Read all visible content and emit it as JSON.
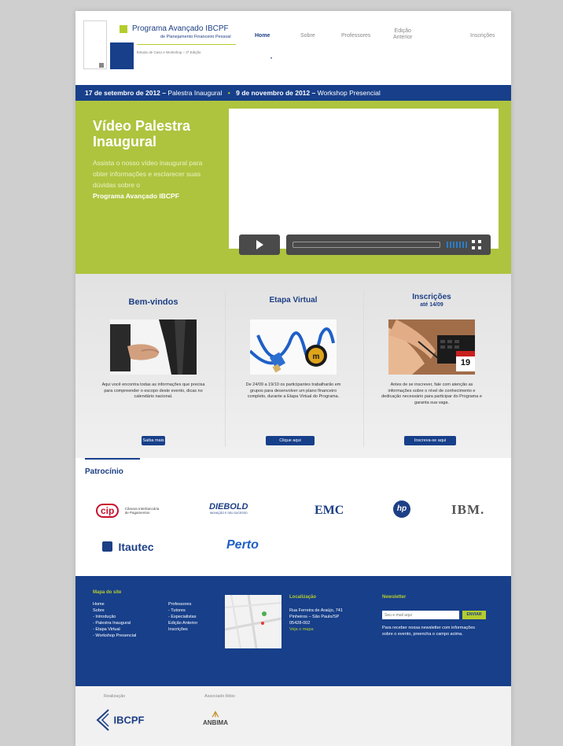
{
  "header": {
    "title": "Programa Avançado IBCPF",
    "subtitle": "de Planejamento Financeiro Pessoal",
    "tagline": "Estudo de Caso e Workshop – 2ª Edição"
  },
  "nav": {
    "items": [
      {
        "label": "Home"
      },
      {
        "label": "Sobre"
      },
      {
        "label": "Professores"
      },
      {
        "label": "Edição\nAnterior"
      },
      {
        "label": "Inscrições"
      }
    ]
  },
  "datebar": {
    "date1": "17 de setembro de 2012 –",
    "event1": "Palestra Inaugural",
    "bullet": "•",
    "date2": "9 de novembro de 2012 –",
    "event2": "Workshop Presencial"
  },
  "hero": {
    "title": "Vídeo Palestra Inaugural",
    "text": "Assista o nosso vídeo inaugural para obter informações e esclarecer suas dúvidas sobre o",
    "highlight": "Programa Avançado IBCPF"
  },
  "columns": [
    {
      "title": "Bem-vindos",
      "subtitle": "",
      "text": "Aqui você encontra todas as informações que precisa para compreender o escopo deste evento, dicas no calendário nacional.",
      "button": "Saiba mais"
    },
    {
      "title": "Etapa Virtual",
      "subtitle": "",
      "text": "De 24/09 a 19/10 os participantes trabalharão em grupos para desenvolver um plano financeiro completo, durante a Etapa Virtual do Programa.",
      "button": "Clique aqui"
    },
    {
      "title": "Inscrições",
      "subtitle": "até 14/09",
      "text": "Antes de se inscrever, fale com atenção as informações sobre o nível de conhecimento e dedicação necessário para participar do Programa e garanta sua vaga.",
      "button": "Inscreva-se aqui"
    }
  ],
  "calendar_day": "19",
  "sponsors": {
    "title": "Patrocínio",
    "cip": "cip",
    "cip_text": "Câmara Interbancária de Pagamentos",
    "diebold": "DIEBOLD",
    "diebold_tag": "INOVAÇÃO E SEU SUCESSO",
    "emc": "EMC",
    "hp": "hp",
    "ibm": "IBM.",
    "itautec": "Itautec",
    "perto": "Perto"
  },
  "footer": {
    "map_title": "Mapa do site",
    "col1": [
      "Home",
      "Sobre",
      "- Introdução",
      "- Palestra Inaugural",
      "- Etapa Virtual",
      "- Workshop Presencial"
    ],
    "col2": [
      "Professores",
      "- Tutores",
      "- Especialistas",
      "Edição Anterior",
      "Inscrições"
    ],
    "loc_title": "Localização",
    "loc_lines": [
      "Rua Ferreira de Araújo, 741",
      "Pinheiros – São Paulo/SP",
      "05428-002"
    ],
    "loc_link": "Veja o mapa",
    "nl_title": "Newsletter",
    "nl_placeholder": "Seu e-mail aqui",
    "nl_button": "ENVIAR",
    "nl_text": "Para receber nossa newsletter com informações sobre o evento, preencha o campo acima."
  },
  "partners": {
    "label1": "Realização",
    "label2": "Associado Ibbio",
    "ibcpf": "IBCPF",
    "anbima": "ANBIMA"
  },
  "colors": {
    "navy": "#173f8a",
    "lime": "#aec43e",
    "accent": "#b5cc2e"
  }
}
